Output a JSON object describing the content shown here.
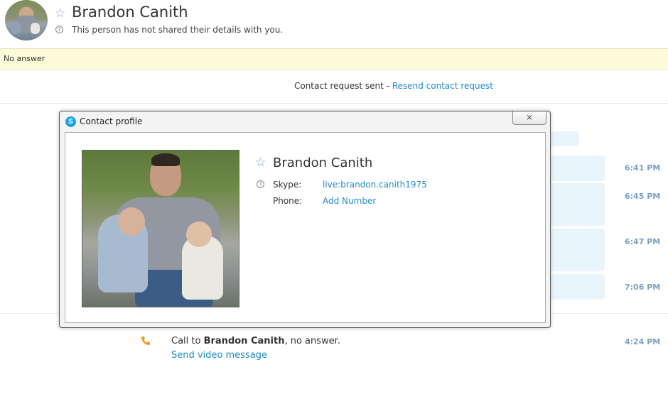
{
  "header": {
    "contact_name": "Brandon Canith",
    "subtitle": "This person has not shared their details with you."
  },
  "banner": {
    "text": "No answer"
  },
  "request": {
    "prefix": "Contact request sent - ",
    "link": "Resend contact request"
  },
  "chat_times": [
    "6:41 PM",
    "6:45 PM",
    "6:47 PM",
    "7:06 PM"
  ],
  "call": {
    "prefix": "Call to ",
    "name": "Brandon Canith",
    "suffix": ", no answer.",
    "link": "Send video message",
    "time": "4:24 PM"
  },
  "dialog": {
    "title": "Contact profile",
    "close_symbol": "⨯",
    "name": "Brandon Canith",
    "skype_label": "Skype:",
    "skype_value": "live:brandon.canith1975",
    "phone_label": "Phone:",
    "phone_value": "Add Number"
  },
  "icons": {
    "favorite": "star-outline-icon",
    "info": "question-icon",
    "phone": "phone-icon",
    "app": "skype-logo-icon"
  },
  "colors": {
    "link": "#1f8cc6",
    "banner_bg": "#fcfbd7",
    "bubble_bg": "#e8f5fc",
    "time": "#7aa2c2",
    "phone_icon": "#f29b1d"
  }
}
